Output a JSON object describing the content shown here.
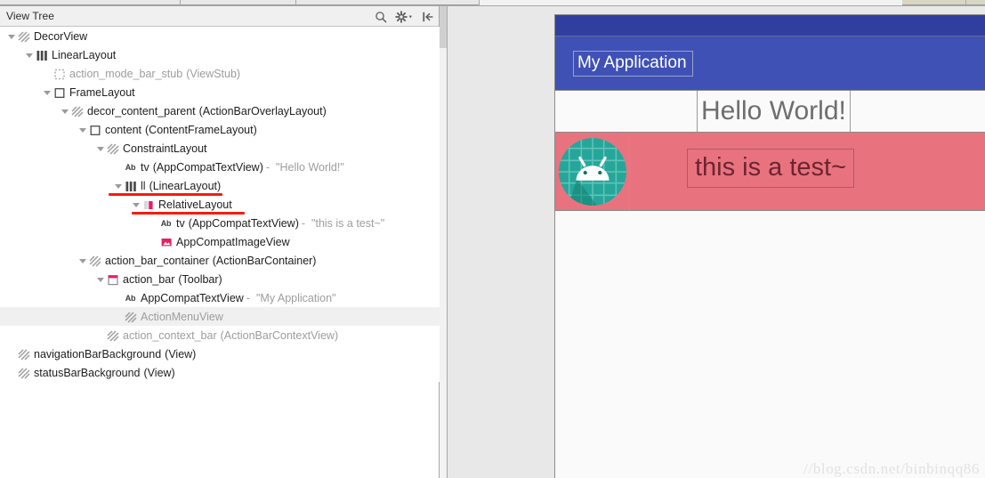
{
  "panel": {
    "title": "View Tree",
    "actions": [
      {
        "name": "search-icon",
        "label": "Search"
      },
      {
        "name": "gear-icon",
        "label": "Settings"
      },
      {
        "name": "collapse-panel-icon",
        "label": "Hide"
      }
    ]
  },
  "tree": {
    "rows": [
      {
        "depth": 0,
        "caret": "down",
        "icon": "hatched",
        "label": "DecorView",
        "paren": "",
        "value": "",
        "dim": false,
        "selected": false
      },
      {
        "depth": 1,
        "caret": "down",
        "icon": "bars",
        "label": "LinearLayout",
        "paren": "",
        "value": "",
        "dim": false,
        "selected": false
      },
      {
        "depth": 2,
        "caret": "none",
        "icon": "dotted",
        "label": "action_mode_bar_stub",
        "paren": "(ViewStub)",
        "value": "",
        "dim": true,
        "selected": false
      },
      {
        "depth": 2,
        "caret": "down",
        "icon": "square",
        "label": "FrameLayout",
        "paren": "",
        "value": "",
        "dim": false,
        "selected": false
      },
      {
        "depth": 3,
        "caret": "down",
        "icon": "hatched",
        "label": "decor_content_parent",
        "paren": "(ActionBarOverlayLayout)",
        "value": "",
        "dim": false,
        "selected": false
      },
      {
        "depth": 4,
        "caret": "down",
        "icon": "square",
        "label": "content",
        "paren": "(ContentFrameLayout)",
        "value": "",
        "dim": false,
        "selected": false
      },
      {
        "depth": 5,
        "caret": "down",
        "icon": "hatched",
        "label": "ConstraintLayout",
        "paren": "",
        "value": "",
        "dim": false,
        "selected": false
      },
      {
        "depth": 6,
        "caret": "none",
        "icon": "ab",
        "label": "tv",
        "paren": "(AppCompatTextView)",
        "value": "\"Hello World!\"",
        "dim": false,
        "selected": false
      },
      {
        "depth": 6,
        "caret": "down",
        "icon": "bars",
        "label": "ll",
        "paren": "(LinearLayout)",
        "value": "",
        "dim": false,
        "selected": false
      },
      {
        "depth": 7,
        "caret": "down",
        "icon": "relative",
        "label": "RelativeLayout",
        "paren": "",
        "value": "",
        "dim": false,
        "selected": false
      },
      {
        "depth": 8,
        "caret": "none",
        "icon": "ab",
        "label": "tv",
        "paren": "(AppCompatTextView)",
        "value": "\"this is a test~\"",
        "dim": false,
        "selected": false
      },
      {
        "depth": 8,
        "caret": "none",
        "icon": "image",
        "label": "AppCompatImageView",
        "paren": "",
        "value": "",
        "dim": false,
        "selected": false
      },
      {
        "depth": 4,
        "caret": "down",
        "icon": "hatched",
        "label": "action_bar_container",
        "paren": "(ActionBarContainer)",
        "value": "",
        "dim": false,
        "selected": false
      },
      {
        "depth": 5,
        "caret": "down",
        "icon": "toolbar",
        "label": "action_bar",
        "paren": "(Toolbar)",
        "value": "",
        "dim": false,
        "selected": false
      },
      {
        "depth": 6,
        "caret": "none",
        "icon": "ab",
        "label": "AppCompatTextView",
        "paren": "",
        "value": "\"My Application\"",
        "dim": false,
        "selected": false
      },
      {
        "depth": 6,
        "caret": "none",
        "icon": "hatched",
        "label": "ActionMenuView",
        "paren": "",
        "value": "",
        "dim": true,
        "selected": true
      },
      {
        "depth": 5,
        "caret": "none",
        "icon": "hatched",
        "label": "action_context_bar",
        "paren": "(ActionBarContextView)",
        "value": "",
        "dim": true,
        "selected": false
      },
      {
        "depth": 0,
        "caret": "none",
        "icon": "hatched",
        "label": "navigationBarBackground",
        "paren": "(View)",
        "value": "",
        "dim": false,
        "selected": false
      },
      {
        "depth": 0,
        "caret": "none",
        "icon": "hatched",
        "label": "statusBarBackground",
        "paren": "(View)",
        "value": "",
        "dim": false,
        "selected": false
      }
    ],
    "annotations": {
      "underline_color": "#f51d0f",
      "marks": [
        {
          "name": "linearlayout-underline",
          "target": "ll (LinearLayout)"
        },
        {
          "name": "relativelayout-underline",
          "target": "RelativeLayout"
        }
      ]
    }
  },
  "preview": {
    "app_title": "My Application",
    "hello_text": "Hello World!",
    "test_text": "this is a test~",
    "avatar_icon": "android-robot-icon",
    "watermark": "//blog.csdn.net/binbinqq86",
    "colors": {
      "status_bar": "#303f9f",
      "app_bar": "#3f51b5",
      "pink_row": "#e8737f",
      "avatar_circle": "#26a69a",
      "surface": "#fafafa"
    }
  }
}
